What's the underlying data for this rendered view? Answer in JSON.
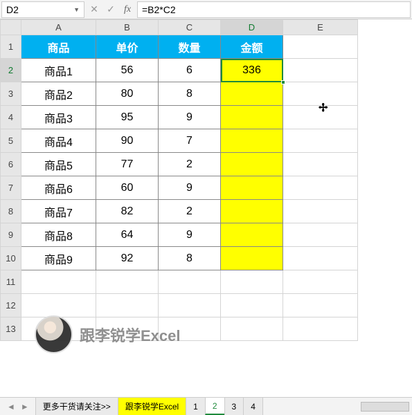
{
  "nameBox": "D2",
  "formula": "=B2*C2",
  "columns": [
    "A",
    "B",
    "C",
    "D",
    "E"
  ],
  "activeCol": "D",
  "activeRow": 2,
  "headerRow": {
    "a": "商品",
    "b": "单价",
    "c": "数量",
    "d": "金额"
  },
  "rows": [
    {
      "n": 1
    },
    {
      "n": 2,
      "a": "商品1",
      "b": "56",
      "c": "6",
      "d": "336"
    },
    {
      "n": 3,
      "a": "商品2",
      "b": "80",
      "c": "8",
      "d": ""
    },
    {
      "n": 4,
      "a": "商品3",
      "b": "95",
      "c": "9",
      "d": ""
    },
    {
      "n": 5,
      "a": "商品4",
      "b": "90",
      "c": "7",
      "d": ""
    },
    {
      "n": 6,
      "a": "商品5",
      "b": "77",
      "c": "2",
      "d": ""
    },
    {
      "n": 7,
      "a": "商品6",
      "b": "60",
      "c": "9",
      "d": ""
    },
    {
      "n": 8,
      "a": "商品7",
      "b": "82",
      "c": "2",
      "d": ""
    },
    {
      "n": 9,
      "a": "商品8",
      "b": "64",
      "c": "9",
      "d": ""
    },
    {
      "n": 10,
      "a": "商品9",
      "b": "92",
      "c": "8",
      "d": ""
    },
    {
      "n": 11
    },
    {
      "n": 12
    },
    {
      "n": 13
    }
  ],
  "watermark": "跟李锐学Excel",
  "tabs": [
    {
      "label": "更多干货请关注>>",
      "style": ""
    },
    {
      "label": "跟李锐学Excel",
      "style": "yellow"
    },
    {
      "label": "1",
      "style": ""
    },
    {
      "label": "2",
      "style": "active"
    },
    {
      "label": "3",
      "style": ""
    },
    {
      "label": "4",
      "style": ""
    }
  ],
  "chart_data": {
    "type": "table",
    "columns": [
      "商品",
      "单价",
      "数量",
      "金额"
    ],
    "data": [
      [
        "商品1",
        56,
        6,
        336
      ],
      [
        "商品2",
        80,
        8,
        null
      ],
      [
        "商品3",
        95,
        9,
        null
      ],
      [
        "商品4",
        90,
        7,
        null
      ],
      [
        "商品5",
        77,
        2,
        null
      ],
      [
        "商品6",
        60,
        9,
        null
      ],
      [
        "商品7",
        82,
        2,
        null
      ],
      [
        "商品8",
        64,
        9,
        null
      ],
      [
        "商品9",
        92,
        8,
        null
      ]
    ]
  }
}
